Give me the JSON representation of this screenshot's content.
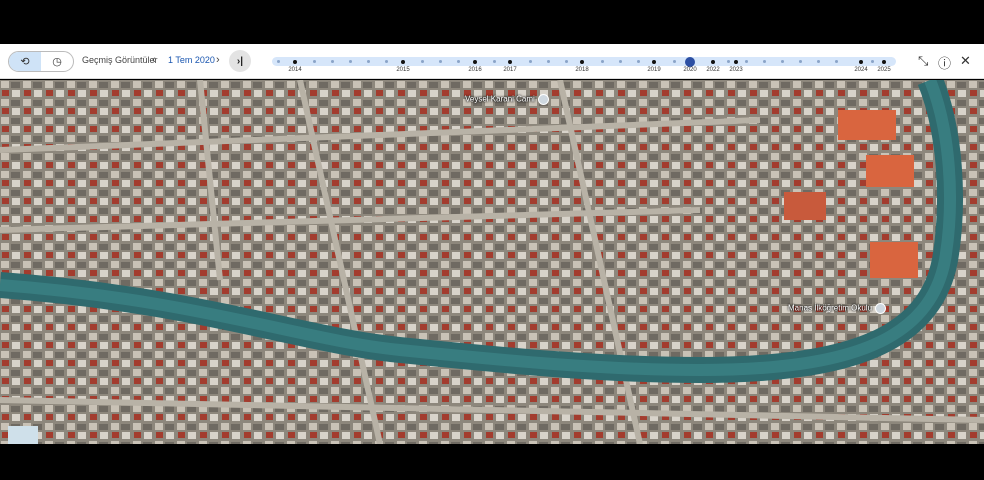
{
  "toolbar": {
    "title": "Geçmiş Görüntüler",
    "date": "1 Tem 2020",
    "prev_icon": "chevron-left-icon",
    "next_icon": "chevron-right-icon",
    "latest_icon": "skip-to-end-icon",
    "history_icon": "history-icon",
    "recent_icon": "clock-icon",
    "collapse_icon": "collapse-icon",
    "help_icon": "help-icon",
    "close_icon": "close-icon"
  },
  "timeline": {
    "years": [
      "2014",
      "2015",
      "2016",
      "2017",
      "2018",
      "2019",
      "2020",
      "2022",
      "2023",
      "2024",
      "2025"
    ],
    "selected": "2020"
  },
  "map": {
    "places": [
      {
        "name": "Veysel Karani Cami",
        "icon": "mosque-icon"
      },
      {
        "name": "Manas İlköğretim Okulu",
        "icon": "school-icon"
      }
    ]
  }
}
